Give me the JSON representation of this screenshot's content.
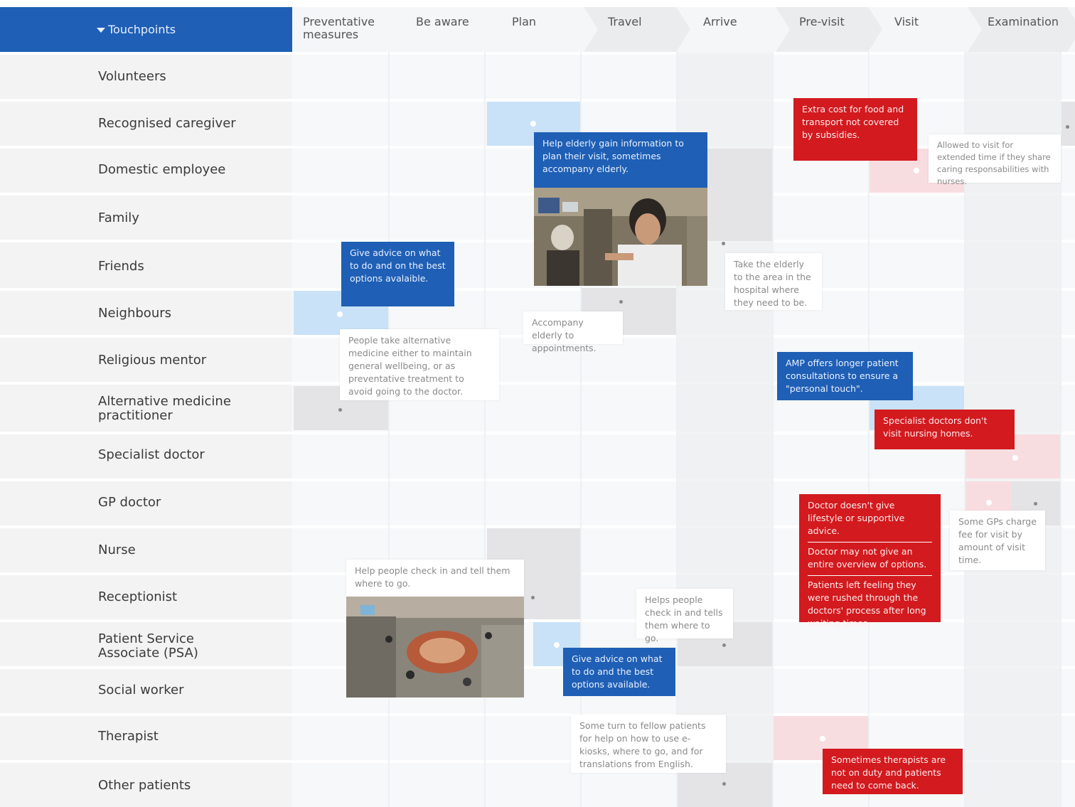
{
  "header": {
    "touchpoints_label": "Touchpoints"
  },
  "stages": [
    "Preventative measures",
    "Be aware",
    "Plan",
    "Travel",
    "Arrive",
    "Pre-visit",
    "Visit",
    "Examination"
  ],
  "rows": [
    "Volunteers",
    "Recognised caregiver",
    "Domestic employee",
    "Family",
    "Friends",
    "Neighbours",
    "Religious mentor",
    "Alternative medicine practitioner",
    "Specialist doctor",
    "GP doctor",
    "Nurse",
    "Receptionist",
    "Patient Service Associate (PSA)",
    "Social worker",
    "Therapist",
    "Other patients"
  ],
  "cards": {
    "help_elderly": "Help elderly gain information to plan their visit, sometimes accompany elderly.",
    "extra_cost": "Extra cost for food and transport not covered by subsidies.",
    "allowed_visit": "Allowed to visit for extended time if they share caring responsabilities with nurses.",
    "give_advice_1": "Give advice on what to do and on the best options avalaible.",
    "take_elderly": "Take the elderly to the area in the hospital where they need to be.",
    "accompany": "Accompany elderly to appointments.",
    "alt_medicine": "People take alternative medicine either to maintain general wellbeing, or as preventative treatment to avoid going to the doctor.",
    "amp_offers": "AMP offers longer patient consultations to ensure a \"personal touch\".",
    "specialist_no_visit": "Specialist doctors don't visit nursing homes.",
    "doctor_1": "Doctor doesn't give lifestyle or supportive advice.",
    "doctor_2": "Doctor may not give an entire overview of options.",
    "doctor_3": "Patients left feeling they were rushed through the doctors' process after long waiting times.",
    "gp_charge": "Some GPs charge fee for visit by amount of visit time.",
    "help_checkin_1": "Help people check in and tell them where to go.",
    "help_checkin_2": "Helps people check in and tells them where to go.",
    "give_advice_2": "Give advice on what to do and the best options available.",
    "fellow_patients": "Some turn to fellow patients for help on how to use e-kiosks, where to go, and for translations from English.",
    "therapists": "Sometimes therapists are not on duty and patients need to come back."
  },
  "colors": {
    "header_blue": "#1f5fb5",
    "card_blue": "#1f5fb5",
    "card_red": "#d21a1f",
    "cell_blue": "#c9e2f8",
    "cell_gray": "#e4e4e6",
    "cell_pink": "#f8dde0"
  }
}
